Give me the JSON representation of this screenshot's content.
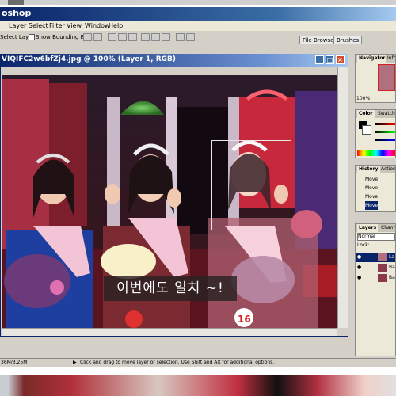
{
  "app": {
    "title": "oshop"
  },
  "menu": [
    "Layer",
    "Select",
    "Filter",
    "View",
    "Window",
    "Help"
  ],
  "options": {
    "auto_select": "Select Layer",
    "bounding_box": "Show Bounding Box"
  },
  "palette_tabs": [
    "File Browser",
    "Brushes"
  ],
  "document": {
    "title": "VIQIFC2w6bfZj4.jpg @ 100% (Layer 1, RGB)",
    "caption": "이번에도 일치 ~!",
    "badge_number": "16"
  },
  "status": {
    "doc_size": "36M/3.25M",
    "hint": "Click and drag to move layer or selection. Use Shift and Alt for additional options."
  },
  "navigator": {
    "tab": "Navigator",
    "tab2": "Info",
    "zoom": "100%"
  },
  "color_panel": {
    "tab": "Color",
    "tab2": "Swatches"
  },
  "history": {
    "tab": "History",
    "tab2": "Actions",
    "items": [
      "Move",
      "Move",
      "Move",
      "Move"
    ]
  },
  "layers": {
    "tab": "Layers",
    "tab2": "Channels",
    "blend": "Normal",
    "lock": "Lock:",
    "layer_names": [
      "La",
      "Ba",
      "Ba"
    ]
  },
  "colors": {
    "title_blue": "#0a246a",
    "chrome": "#d4d0c8"
  }
}
